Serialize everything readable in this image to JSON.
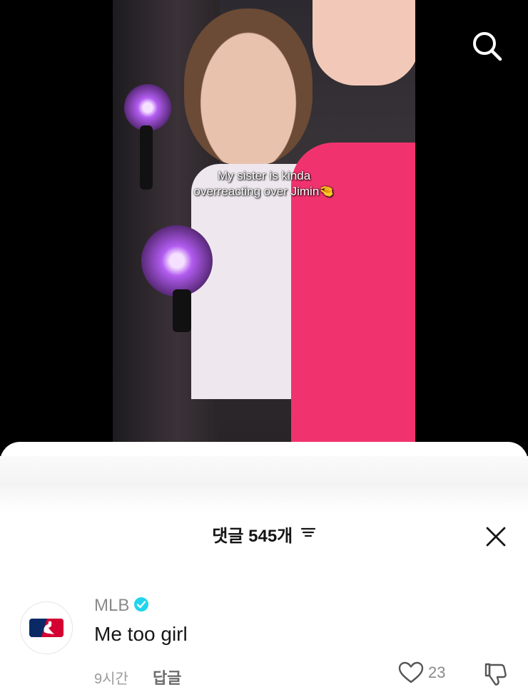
{
  "video": {
    "caption_line1": "My sister is kinda",
    "caption_line2": "overreacting over Jimin",
    "caption_emoji": "🤏"
  },
  "top_bar": {
    "search_icon": "search-icon"
  },
  "comments_sheet": {
    "title": "댓글 545개",
    "sort_icon": "sort-icon",
    "close_icon": "close-icon",
    "comment": {
      "username": "MLB",
      "verified_color": "#20D5EC",
      "text": "Me too girl",
      "time": "9시간",
      "reply_label": "답글",
      "like_count": "23"
    }
  }
}
